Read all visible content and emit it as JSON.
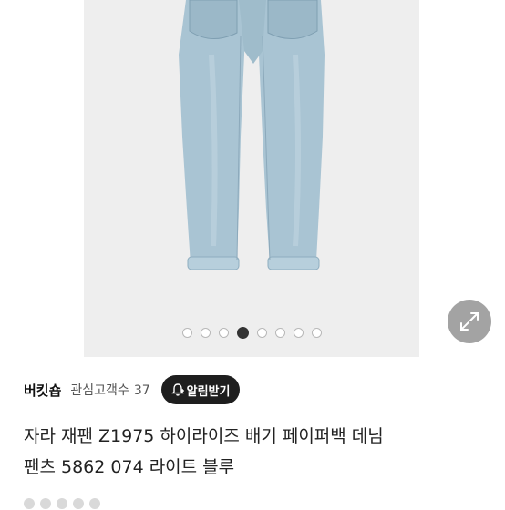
{
  "product_image": {
    "alt_icon": "jeans-photo",
    "slide_count": 8,
    "active_slide": 4,
    "expand_icon": "expand-arrows-icon"
  },
  "seller": {
    "name": "버킷숍",
    "fans_label": "관심고객수",
    "fans_count": "37",
    "notify_button": "알림받기",
    "notify_icon": "bell-plus-icon"
  },
  "product": {
    "title_line1": "자라 재팬 Z1975 하이라이즈 배기 페이퍼백 데님",
    "title_line2": "팬츠 5862 074 라이트 블루"
  },
  "colors": {
    "denim": "#a9c4d3",
    "button_bg": "#1e1e1e",
    "overlay_btn": "#a3a3a3"
  }
}
